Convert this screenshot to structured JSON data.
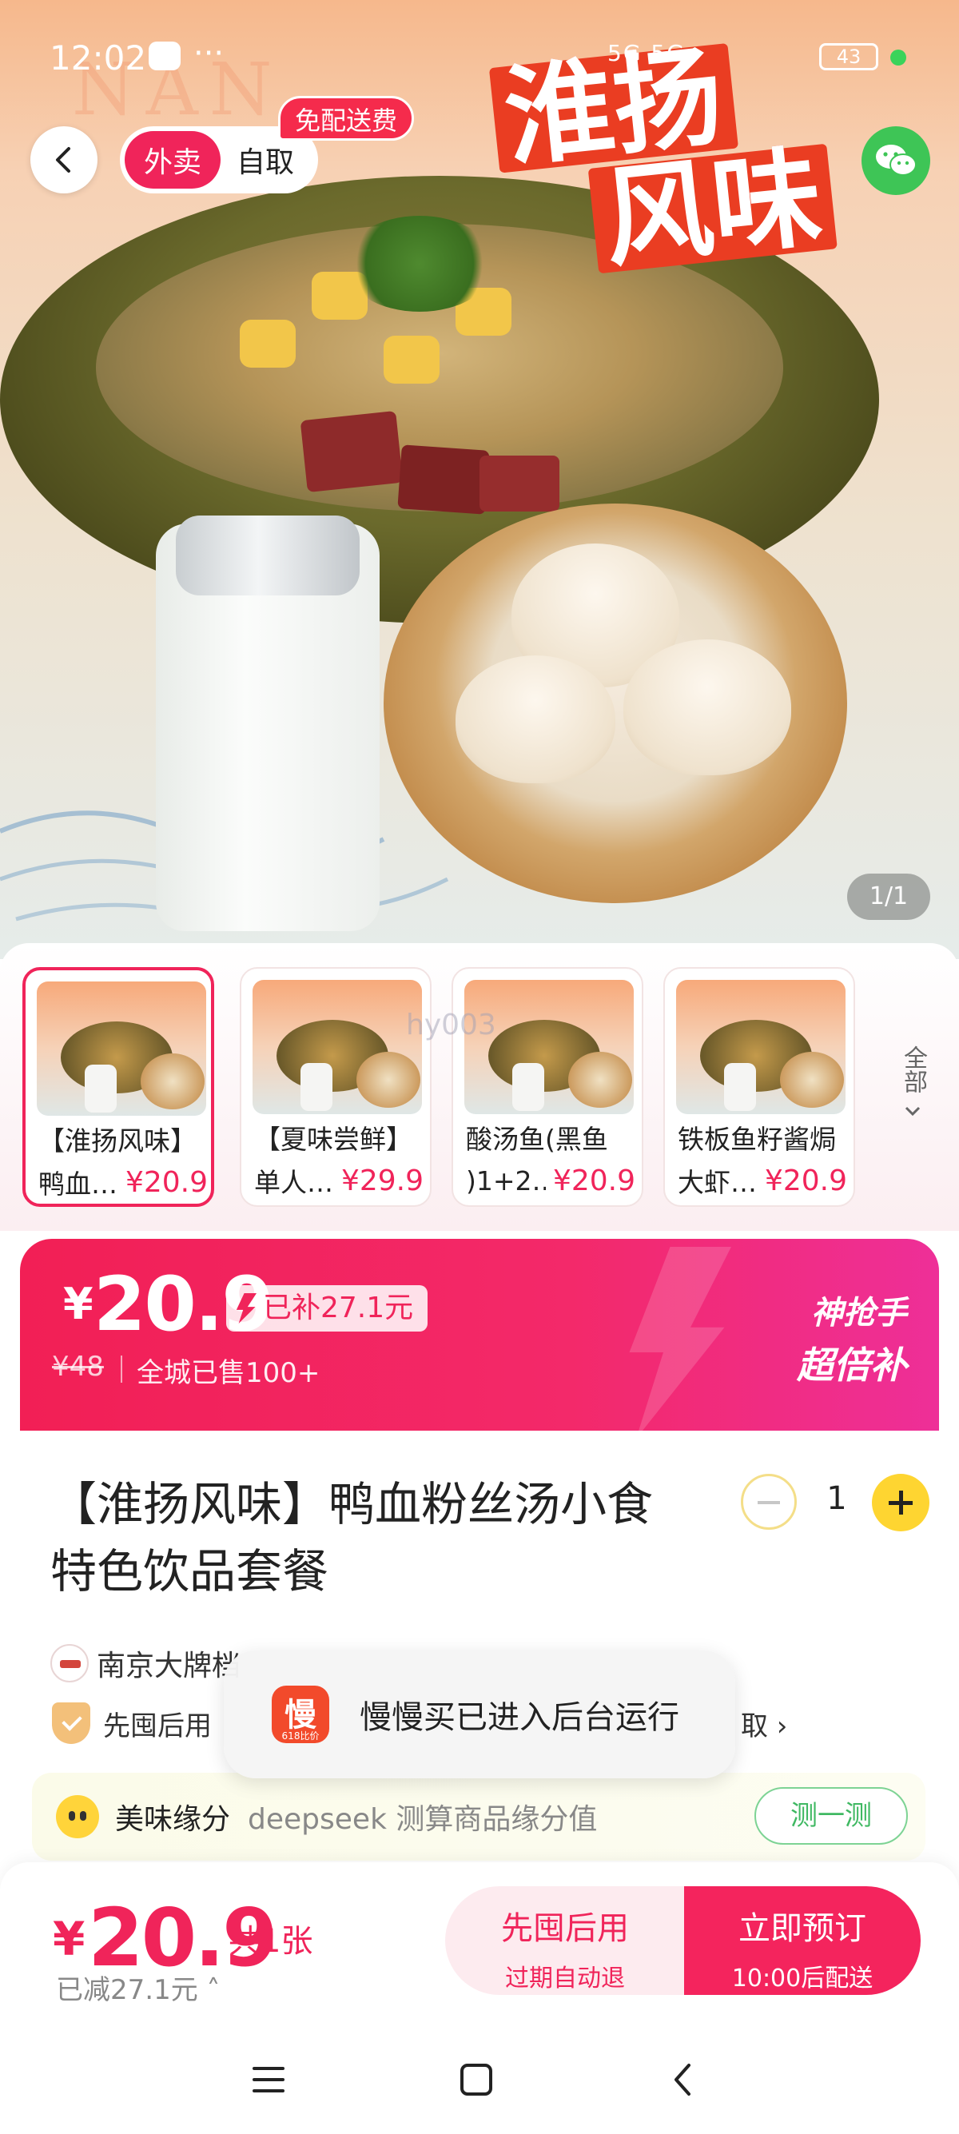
{
  "status_bar": {
    "time": "12:02",
    "more": "···",
    "signal": "5G 5G",
    "battery": "43"
  },
  "hero": {
    "title_line1": "淮扬",
    "title_line2": "风味",
    "watermark": "NAN",
    "counter": "1/1"
  },
  "top": {
    "mode_delivery": "外卖",
    "mode_pickup": "自取",
    "free_badge": "免配送费"
  },
  "thumbs": {
    "all_label": "全部",
    "items": [
      {
        "name": "【淮扬风味】",
        "sub": "鸭血…",
        "price": "¥20.9"
      },
      {
        "name": "【夏味尝鲜】",
        "sub": "单人…",
        "price": "¥29.9"
      },
      {
        "name": "酸汤鱼(黑鱼",
        "sub": ")1+2…",
        "price": "¥20.9"
      },
      {
        "name": "铁板鱼籽酱焗",
        "sub": "大虾…",
        "price": "¥20.9"
      }
    ],
    "overlay": "hy003"
  },
  "banner": {
    "currency": "¥",
    "price": "20.9",
    "subsidy": "已补27.1元",
    "original": "¥48",
    "sold": "全城已售100+",
    "tag1": "神抢手",
    "tag2": "超倍补"
  },
  "product": {
    "title": "【淮扬风味】鸭血粉丝汤小食特色饮品套餐",
    "qty": "1",
    "shop": "南京大牌档",
    "credit": "先囤后用",
    "credit_right": "取 ›"
  },
  "toast": {
    "app_char": "慢",
    "app_sub": "618比价",
    "message": "慢慢买已进入后台运行"
  },
  "match": {
    "label": "美味缘分",
    "desc": "deepseek 测算商品缘分值",
    "button": "测一测"
  },
  "bottom": {
    "currency": "¥",
    "price": "20.9",
    "count": "共1张",
    "saved": "已减27.1元 ˄",
    "btn_left_1": "先囤后用",
    "btn_left_2": "过期自动退",
    "btn_right_1": "立即预订",
    "btn_right_2": "10:00后配送"
  },
  "colors": {
    "brand": "#f0245a",
    "accent_yellow": "#fed531",
    "green": "#3ec556"
  },
  "icons": {
    "back": "chevron-left-icon",
    "share": "wechat-icon",
    "menu": "menu-icon",
    "home": "square-icon",
    "nav_back": "chevron-left-icon"
  }
}
